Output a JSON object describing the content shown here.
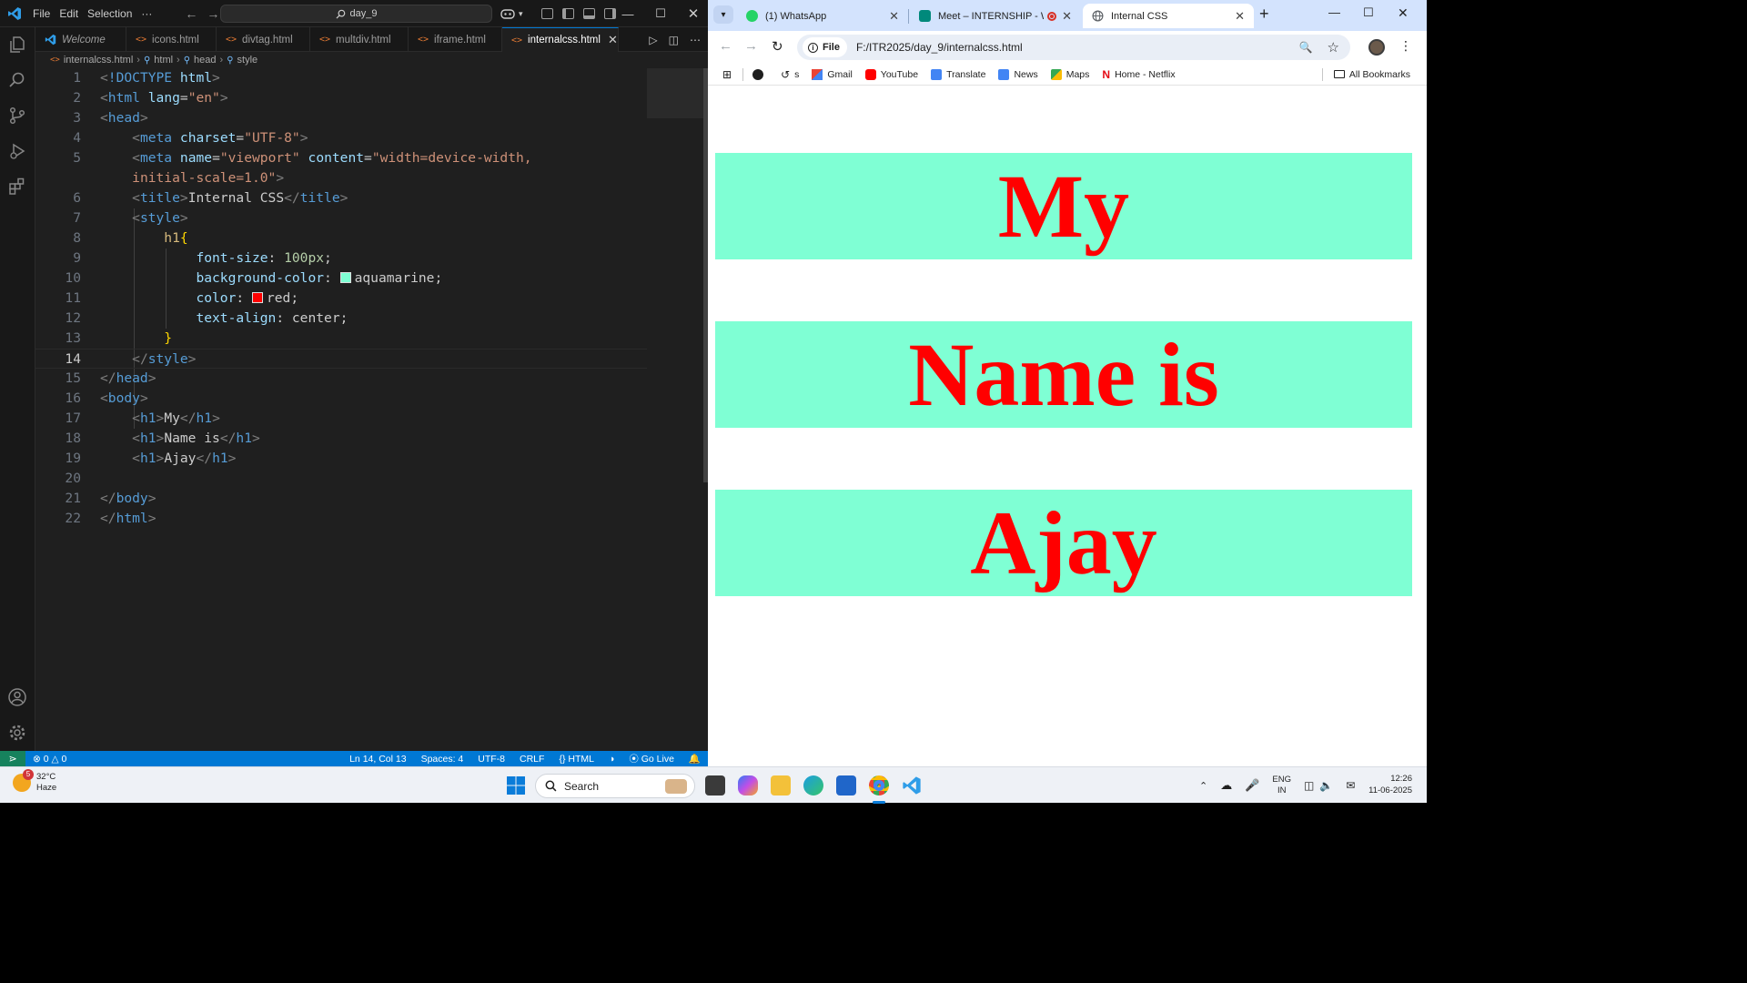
{
  "vscode": {
    "menu": [
      "File",
      "Edit",
      "Selection",
      "···"
    ],
    "command_center": "day_9",
    "tabs": [
      {
        "label": "Welcome",
        "italic": true
      },
      {
        "label": "icons.html"
      },
      {
        "label": "divtag.html"
      },
      {
        "label": "multdiv.html"
      },
      {
        "label": "iframe.html"
      },
      {
        "label": "internalcss.html",
        "active": true
      }
    ],
    "breadcrumb": [
      "internalcss.html",
      "html",
      "head",
      "style"
    ],
    "code": {
      "l1_doctype": "!DOCTYPE",
      "l1_html": "html",
      "l2_tag": "html",
      "l2_attr": "lang",
      "l2_val": "\"en\"",
      "l3_tag": "head",
      "l4_tag": "meta",
      "l4_attr": "charset",
      "l4_val": "\"UTF-8\"",
      "l5_tag": "meta",
      "l5_attr1": "name",
      "l5_val1": "\"viewport\"",
      "l5_attr2": "content",
      "l5_val2a": "\"width=device-width,",
      "l5_val2b": "initial-scale=1.0\"",
      "l6_tag": "title",
      "l6_text": "Internal CSS",
      "l7_tag": "style",
      "l8_sel": "h1",
      "l9_prop": "font-size",
      "l9_val": "100px",
      "l10_prop": "background-color",
      "l10_val": "aquamarine",
      "l11_prop": "color",
      "l11_val": "red",
      "l12_prop": "text-align",
      "l12_val": "center",
      "l14_tag": "style",
      "l15_tag": "head",
      "l16_tag": "body",
      "l17_tag": "h1",
      "l17_text": "My",
      "l18_tag": "h1",
      "l18_text": "Name is",
      "l19_tag": "h1",
      "l19_text": "Ajay",
      "l21_tag": "body",
      "l22_tag": "html"
    },
    "line_numbers": [
      "1",
      "2",
      "3",
      "4",
      "5",
      "",
      "6",
      "7",
      "8",
      "9",
      "10",
      "11",
      "12",
      "13",
      "14",
      "15",
      "16",
      "17",
      "18",
      "19",
      "20",
      "21",
      "22"
    ],
    "status": {
      "errors": "0",
      "warnings": "0",
      "position": "Ln 14, Col 13",
      "spaces": "Spaces: 4",
      "encoding": "UTF-8",
      "eol": "CRLF",
      "language": "HTML",
      "golive": "Go Live"
    }
  },
  "chrome": {
    "tabs": [
      {
        "label": "(1) WhatsApp",
        "favicon_color": "#25d366"
      },
      {
        "label": "Meet – INTERNSHIP - WEB",
        "favicon_color": "#00897b",
        "recording": true
      },
      {
        "label": "Internal CSS",
        "active": true,
        "favicon_color": "#5f6368"
      }
    ],
    "chip": "File",
    "url": "F:/ITR2025/day_9/internalcss.html",
    "bookmarks": [
      {
        "label": "",
        "icon": "globe-icon"
      },
      {
        "label": "s",
        "icon": "history-icon"
      },
      {
        "label": "Gmail",
        "icon": "gmail-icon"
      },
      {
        "label": "YouTube",
        "icon": "youtube-icon"
      },
      {
        "label": "Translate",
        "icon": "translate-icon"
      },
      {
        "label": "News",
        "icon": "news-icon"
      },
      {
        "label": "Maps",
        "icon": "maps-icon"
      },
      {
        "label": "Home - Netflix",
        "icon": "netflix-icon"
      }
    ],
    "all_bookmarks": "All Bookmarks",
    "page": {
      "headings": [
        "My",
        "Name is",
        "Ajay"
      ],
      "heading_bg": "aquamarine",
      "heading_color": "red"
    }
  },
  "taskbar": {
    "weather_temp": "32°C",
    "weather_desc": "Haze",
    "weather_badge": "5",
    "search": "Search",
    "lang_top": "ENG",
    "lang_bottom": "IN",
    "time": "12:26",
    "date": "11-06-2025"
  }
}
